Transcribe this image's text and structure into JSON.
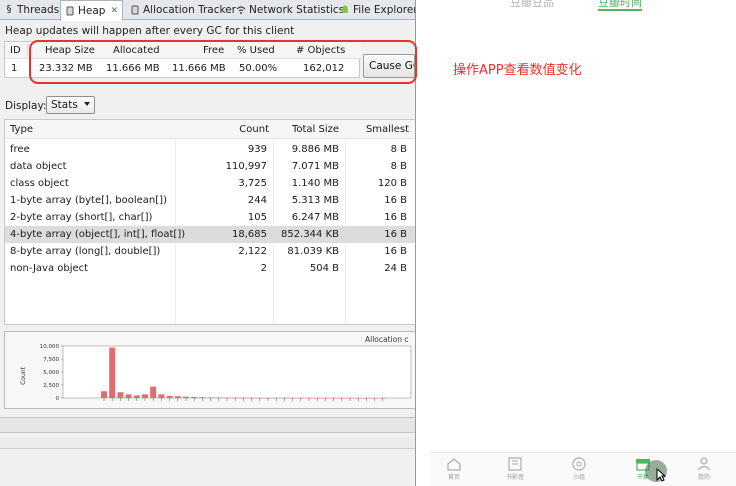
{
  "tabs": [
    {
      "label": "Threads",
      "icon": "threads-icon"
    },
    {
      "label": "Heap",
      "icon": "heap-icon",
      "active": true
    },
    {
      "label": "Allocation Tracker",
      "icon": "allocation-icon"
    },
    {
      "label": "Network Statistics",
      "icon": "wifi-icon"
    },
    {
      "label": "File Explorer",
      "icon": "android-icon"
    }
  ],
  "heap_message": "Heap updates will happen after every GC for this client",
  "summary": {
    "headers": [
      "ID",
      "Heap Size",
      "Allocated",
      "Free",
      "% Used",
      "# Objects"
    ],
    "row": [
      "1",
      "23.332 MB",
      "11.666 MB",
      "11.666 MB",
      "50.00%",
      "162,012"
    ]
  },
  "cause_gc_label": "Cause GC",
  "display": {
    "label": "Display:",
    "selected": "Stats"
  },
  "stats": {
    "headers": [
      "Type",
      "Count",
      "Total Size",
      "Smallest"
    ],
    "rows": [
      [
        "free",
        "939",
        "9.886 MB",
        "8 B"
      ],
      [
        "data object",
        "110,997",
        "7.071 MB",
        "8 B"
      ],
      [
        "class object",
        "3,725",
        "1.140 MB",
        "120 B"
      ],
      [
        "1-byte array (byte[], boolean[])",
        "244",
        "5.313 MB",
        "16 B"
      ],
      [
        "2-byte array (short[], char[])",
        "105",
        "6.247 MB",
        "16 B"
      ],
      [
        "4-byte array (object[], int[], float[])",
        "18,685",
        "852.344 KB",
        "16 B"
      ],
      [
        "8-byte array (long[], double[])",
        "2,122",
        "81.039 KB",
        "16 B"
      ],
      [
        "non-Java object",
        "2",
        "504 B",
        "24 B"
      ]
    ],
    "selected_index": 5
  },
  "chart_data": {
    "type": "bar",
    "title": "Allocation c",
    "ylabel": "Count",
    "yticks": [
      "10,000",
      "7,500",
      "5,000",
      "2,500",
      "0"
    ],
    "ylim": [
      0,
      10000
    ],
    "values": [
      1300,
      9700,
      1100,
      700,
      500,
      700,
      2200,
      700,
      400,
      350,
      250,
      200,
      150,
      120,
      100,
      80,
      70,
      60,
      50,
      40,
      30,
      30,
      20,
      20,
      15,
      10,
      10,
      10,
      5,
      5,
      5,
      5,
      5,
      5,
      5
    ],
    "bar_color": "#e06e6e"
  },
  "annotation": "操作APP查看数值变化",
  "phone": {
    "top_tabs": [
      "豆瓣豆品",
      "豆瓣时间"
    ],
    "nav": [
      {
        "label": "首页",
        "icon": "home-icon"
      },
      {
        "label": "书影音",
        "icon": "film-icon"
      },
      {
        "label": "小组",
        "icon": "group-icon"
      },
      {
        "label": "市集",
        "icon": "market-icon",
        "active": true
      },
      {
        "label": "我的",
        "icon": "profile-icon"
      }
    ],
    "accent": "#55b35e"
  }
}
